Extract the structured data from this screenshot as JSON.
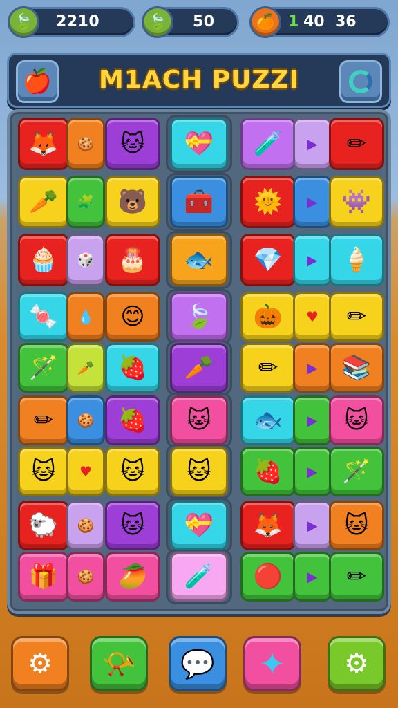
{
  "title": "M1ACH PUZZI",
  "stats": {
    "leaves": "2210",
    "energy": "50",
    "orange_count_green": "1",
    "orange_count_a": "40",
    "orange_count_b": "36"
  },
  "colors": {
    "red": "#e8231f",
    "orange": "#f08020",
    "purple": "#9d3fd6",
    "yellow": "#f7d21c",
    "green": "#43c23b",
    "cyan": "#35d6e8",
    "blue": "#3a8fe0",
    "pink": "#f24fa0",
    "lavender": "#c9a2ef",
    "violet": "#c170f0",
    "yellowgreen": "#c4e23a"
  },
  "tiles": [
    {
      "icon": "fox-icon",
      "glyph": "🦊",
      "color": "#e8231f"
    },
    {
      "icon": "cookie-icon",
      "glyph": "🍪",
      "color": "#f08020",
      "sm": true
    },
    {
      "icon": "cat-icon",
      "glyph": "🐱",
      "color": "#9d3fd6"
    },
    {
      "icon": "heart-box-icon",
      "glyph": "💝",
      "color": "#35d6e8"
    },
    {
      "icon": "potion-icon",
      "glyph": "🧪",
      "color": "#c170f0"
    },
    {
      "icon": "arrow-right-icon",
      "glyph": "▶",
      "color": "#c9a2ef",
      "sm": true
    },
    {
      "icon": "pencil-icon",
      "glyph": "✏",
      "color": "#e8231f"
    },
    {
      "icon": "carrot-icon",
      "glyph": "🥕",
      "color": "#f7d21c"
    },
    {
      "icon": "puzzle-icon",
      "glyph": "🧩",
      "color": "#43c23b",
      "sm": true
    },
    {
      "icon": "bear-icon",
      "glyph": "🐻",
      "color": "#f7d21c"
    },
    {
      "icon": "chest-icon",
      "glyph": "🧰",
      "color": "#3a8fe0"
    },
    {
      "icon": "sun-icon",
      "glyph": "🌞",
      "color": "#e8231f"
    },
    {
      "icon": "arrow-right-icon",
      "glyph": "▶",
      "color": "#3a8fe0",
      "sm": true
    },
    {
      "icon": "blob-icon",
      "glyph": "👾",
      "color": "#f7d21c"
    },
    {
      "icon": "cupcake-icon",
      "glyph": "🧁",
      "color": "#e8231f"
    },
    {
      "icon": "dice-icon",
      "glyph": "🎲",
      "color": "#c9a2ef",
      "sm": true
    },
    {
      "icon": "crown-cake-icon",
      "glyph": "🎂",
      "color": "#e8231f"
    },
    {
      "icon": "fish-icon",
      "glyph": "🐟",
      "color": "#f7a41c"
    },
    {
      "icon": "gem-icon",
      "glyph": "💎",
      "color": "#e8231f"
    },
    {
      "icon": "arrow-right-icon",
      "glyph": "▶",
      "color": "#35d6e8",
      "sm": true
    },
    {
      "icon": "cone-icon",
      "glyph": "🍦",
      "color": "#35d6e8"
    },
    {
      "icon": "candy-icon",
      "glyph": "🍬",
      "color": "#35d6e8"
    },
    {
      "icon": "drop-icon",
      "glyph": "💧",
      "color": "#f08020",
      "sm": true
    },
    {
      "icon": "smile-icon",
      "glyph": "😊",
      "color": "#f08020"
    },
    {
      "icon": "leaf-icon",
      "glyph": "🍃",
      "color": "#c170f0"
    },
    {
      "icon": "pumpkin-icon",
      "glyph": "🎃",
      "color": "#f7d21c"
    },
    {
      "icon": "heart-icon",
      "glyph": "♥",
      "color": "#f7d21c",
      "sm": true
    },
    {
      "icon": "pencil-icon",
      "glyph": "✏",
      "color": "#f7d21c"
    },
    {
      "icon": "wand-icon",
      "glyph": "🪄",
      "color": "#43c23b"
    },
    {
      "icon": "carrot-icon",
      "glyph": "🥕",
      "color": "#c4e23a",
      "sm": true
    },
    {
      "icon": "berry-icon",
      "glyph": "🍓",
      "color": "#35d6e8"
    },
    {
      "icon": "radish-icon",
      "glyph": "🥕",
      "color": "#9d3fd6"
    },
    {
      "icon": "pencil-icon",
      "glyph": "✏",
      "color": "#f7d21c"
    },
    {
      "icon": "arrow-right-icon",
      "glyph": "▶",
      "color": "#f08020",
      "sm": true
    },
    {
      "icon": "book-icon",
      "glyph": "📚",
      "color": "#f08020"
    },
    {
      "icon": "pencil-icon",
      "glyph": "✏",
      "color": "#f08020"
    },
    {
      "icon": "cookie-icon",
      "glyph": "🍪",
      "color": "#3a8fe0",
      "sm": true
    },
    {
      "icon": "strawberry-icon",
      "glyph": "🍓",
      "color": "#9d3fd6"
    },
    {
      "icon": "cat-icon",
      "glyph": "🐱",
      "color": "#f24fa0"
    },
    {
      "icon": "fish-icon",
      "glyph": "🐟",
      "color": "#35d6e8"
    },
    {
      "icon": "arrow-right-icon",
      "glyph": "▶",
      "color": "#43c23b",
      "sm": true
    },
    {
      "icon": "cat-icon",
      "glyph": "🐱",
      "color": "#f24fa0"
    },
    {
      "icon": "cat-icon",
      "glyph": "🐱",
      "color": "#f7d21c"
    },
    {
      "icon": "heart-icon",
      "glyph": "♥",
      "color": "#f7d21c",
      "sm": true
    },
    {
      "icon": "cat-icon",
      "glyph": "🐱",
      "color": "#f7d21c"
    },
    {
      "icon": "cat-icon",
      "glyph": "🐱",
      "color": "#f7d21c"
    },
    {
      "icon": "radish-icon",
      "glyph": "🍓",
      "color": "#43c23b"
    },
    {
      "icon": "arrow-right-icon",
      "glyph": "▶",
      "color": "#43c23b",
      "sm": true
    },
    {
      "icon": "wand-icon",
      "glyph": "🪄",
      "color": "#43c23b"
    },
    {
      "icon": "sheep-icon",
      "glyph": "🐑",
      "color": "#e8231f"
    },
    {
      "icon": "cookie-icon",
      "glyph": "🍪",
      "color": "#c9a2ef",
      "sm": true
    },
    {
      "icon": "cat-icon",
      "glyph": "🐱",
      "color": "#9d3fd6"
    },
    {
      "icon": "heart-box-icon",
      "glyph": "💝",
      "color": "#35d6e8"
    },
    {
      "icon": "fox-icon",
      "glyph": "🦊",
      "color": "#e8231f"
    },
    {
      "icon": "arrow-right-icon",
      "glyph": "▶",
      "color": "#c9a2ef",
      "sm": true
    },
    {
      "icon": "cat-icon",
      "glyph": "🐱",
      "color": "#f08020"
    },
    {
      "icon": "gift-icon",
      "glyph": "🎁",
      "color": "#f24fa0"
    },
    {
      "icon": "cookie-icon",
      "glyph": "🍪",
      "color": "#f24fa0",
      "sm": true
    },
    {
      "icon": "fruit-icon",
      "glyph": "🥭",
      "color": "#f24fa0"
    },
    {
      "icon": "potion-icon",
      "glyph": "🧪",
      "color": "#f7a8f0"
    },
    {
      "icon": "ball-icon",
      "glyph": "🔴",
      "color": "#43c23b"
    },
    {
      "icon": "arrow-right-icon",
      "glyph": "▶",
      "color": "#43c23b",
      "sm": true
    },
    {
      "icon": "pencil-icon",
      "glyph": "✏",
      "color": "#43c23b"
    }
  ],
  "bottom_buttons": [
    {
      "name": "settings-left-button",
      "icon": "gear-icon",
      "glyph": "⚙",
      "color": "#f08020"
    },
    {
      "name": "horn-button",
      "icon": "horn-icon",
      "glyph": "📯",
      "color": "#43c23b"
    },
    {
      "name": "chat-button",
      "icon": "chat-bubble-icon",
      "glyph": "💬",
      "color": "#3a8fe0"
    },
    {
      "name": "star-button",
      "icon": "star-icon",
      "glyph": "✦",
      "color": "#f24fa0"
    },
    {
      "name": "settings-right-button",
      "icon": "gear-icon",
      "glyph": "⚙",
      "color": "#7ac92a"
    }
  ]
}
